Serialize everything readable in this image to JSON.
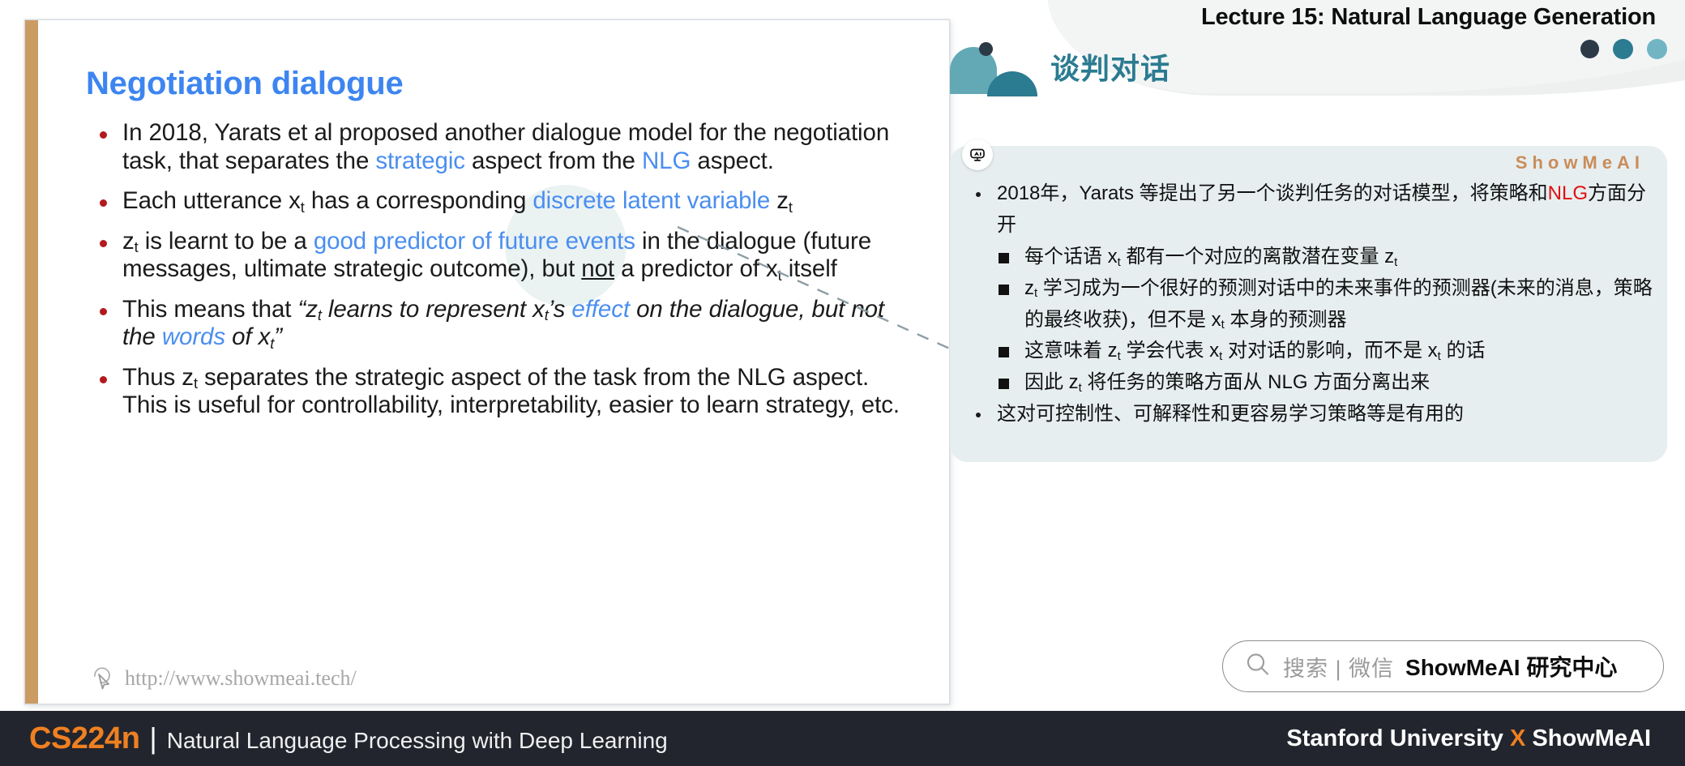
{
  "slide": {
    "title": "Negotiation dialogue",
    "bullets": [
      {
        "id": "b1",
        "parts": [
          {
            "t": "In 2018, Yarats et al proposed another dialogue model for the negotiation task, that separates the ",
            "s": "plain"
          },
          {
            "t": "strategic",
            "s": "hl"
          },
          {
            "t": " aspect from the ",
            "s": "plain"
          },
          {
            "t": "NLG",
            "s": "hl"
          },
          {
            "t": " aspect.",
            "s": "plain"
          }
        ]
      },
      {
        "id": "b2",
        "parts": [
          {
            "t": "Each utterance x",
            "s": "plain"
          },
          {
            "t": "t",
            "s": "sub"
          },
          {
            "t": " has a corresponding ",
            "s": "plain"
          },
          {
            "t": "discrete latent variable",
            "s": "hl"
          },
          {
            "t": " z",
            "s": "plain"
          },
          {
            "t": "t",
            "s": "sub"
          }
        ]
      },
      {
        "id": "b3",
        "parts": [
          {
            "t": "z",
            "s": "plain"
          },
          {
            "t": "t",
            "s": "sub"
          },
          {
            "t": " is learnt to be a ",
            "s": "plain"
          },
          {
            "t": "good predictor of future events",
            "s": "hl"
          },
          {
            "t": " in the dialogue (future messages, ultimate strategic outcome), but ",
            "s": "plain"
          },
          {
            "t": "not",
            "s": "und"
          },
          {
            "t": " a predictor of x",
            "s": "plain"
          },
          {
            "t": "t",
            "s": "sub"
          },
          {
            "t": " itself",
            "s": "plain"
          }
        ]
      },
      {
        "id": "b4",
        "parts": [
          {
            "t": "This means that ",
            "s": "plain"
          },
          {
            "t": "“z",
            "s": "ital"
          },
          {
            "t": "t",
            "s": "italsub"
          },
          {
            "t": " learns to represent x",
            "s": "ital"
          },
          {
            "t": "t",
            "s": "italsub"
          },
          {
            "t": "’s ",
            "s": "ital"
          },
          {
            "t": "effect",
            "s": "italhl"
          },
          {
            "t": " on the dialogue, but not the ",
            "s": "ital"
          },
          {
            "t": "words",
            "s": "italhl"
          },
          {
            "t": " of x",
            "s": "ital"
          },
          {
            "t": "t",
            "s": "italsub"
          },
          {
            "t": "”",
            "s": "ital"
          }
        ]
      },
      {
        "id": "b5",
        "parts": [
          {
            "t": "Thus z",
            "s": "plain"
          },
          {
            "t": "t",
            "s": "sub"
          },
          {
            "t": " separates the strategic aspect of the task from the NLG aspect. This is useful for controllability, interpretability, easier to learn strategy, etc.",
            "s": "plain"
          }
        ]
      }
    ],
    "watermark_url": "http://www.showmeai.tech/",
    "watermark_icon": "cursor-pointer-icon",
    "accent_color": "#cb9b64",
    "highlight_color": "#4a8ef0",
    "bullet_color": "#b3191d",
    "title_color": "#3d85f0"
  },
  "header": {
    "lecture_title": "Lecture 15: Natural Language Generation",
    "cn_title": "谈判对话",
    "logo_icon": "showmeai-mark-icon",
    "dots": [
      "#2b3a46",
      "#2b7b91",
      "#71b5c4"
    ]
  },
  "panel": {
    "badge_icon": "ai-robot-badge-icon",
    "brand": "ShowMeAI",
    "brand_color": "#c98d5a",
    "background": "#e7eef0",
    "items": [
      {
        "level": 1,
        "parts": [
          {
            "t": "2018年，Yarats 等提出了另一个谈判任务的对话模型，将策略和",
            "s": "plain"
          },
          {
            "t": "NLG",
            "s": "red"
          },
          {
            "t": "方面分开",
            "s": "plain"
          }
        ]
      },
      {
        "level": 2,
        "parts": [
          {
            "t": "每个话语 x",
            "s": "plain"
          },
          {
            "t": "t",
            "s": "sub"
          },
          {
            "t": " 都有一个对应的离散潜在变量 z",
            "s": "plain"
          },
          {
            "t": "t",
            "s": "sub"
          }
        ]
      },
      {
        "level": 2,
        "parts": [
          {
            "t": "z",
            "s": "plain"
          },
          {
            "t": "t",
            "s": "sub"
          },
          {
            "t": " 学习成为一个很好的预测对话中的未来事件的预测器(未来的消息，策略的最终收获)，但不是 x",
            "s": "plain"
          },
          {
            "t": "t",
            "s": "sub"
          },
          {
            "t": " 本身的预测器",
            "s": "plain"
          }
        ]
      },
      {
        "level": 2,
        "parts": [
          {
            "t": "这意味着 z",
            "s": "plain"
          },
          {
            "t": "t",
            "s": "sub"
          },
          {
            "t": " 学会代表 x",
            "s": "plain"
          },
          {
            "t": "t",
            "s": "sub"
          },
          {
            "t": " 对对话的影响，而不是 x",
            "s": "plain"
          },
          {
            "t": "t",
            "s": "sub"
          },
          {
            "t": " 的话",
            "s": "plain"
          }
        ]
      },
      {
        "level": 2,
        "parts": [
          {
            "t": "因此 z",
            "s": "plain"
          },
          {
            "t": "t",
            "s": "sub"
          },
          {
            "t": " 将任务的策略方面从 NLG 方面分离出来",
            "s": "plain"
          }
        ]
      },
      {
        "level": 1,
        "parts": [
          {
            "t": "这对可控制性、可解释性和更容易学习策略等是有用的",
            "s": "plain"
          }
        ]
      }
    ]
  },
  "search": {
    "icon": "magnifier-icon",
    "gray_text": "搜索 | 微信",
    "bold_text": "ShowMeAI 研究中心"
  },
  "footer": {
    "course_code": "CS224n",
    "separator": "|",
    "course_name": "Natural Language Processing with Deep Learning",
    "right_pre": "Stanford University ",
    "right_x": "X",
    "right_post": " ShowMeAI",
    "accent_color": "#ef8022",
    "background": "#22252d"
  }
}
